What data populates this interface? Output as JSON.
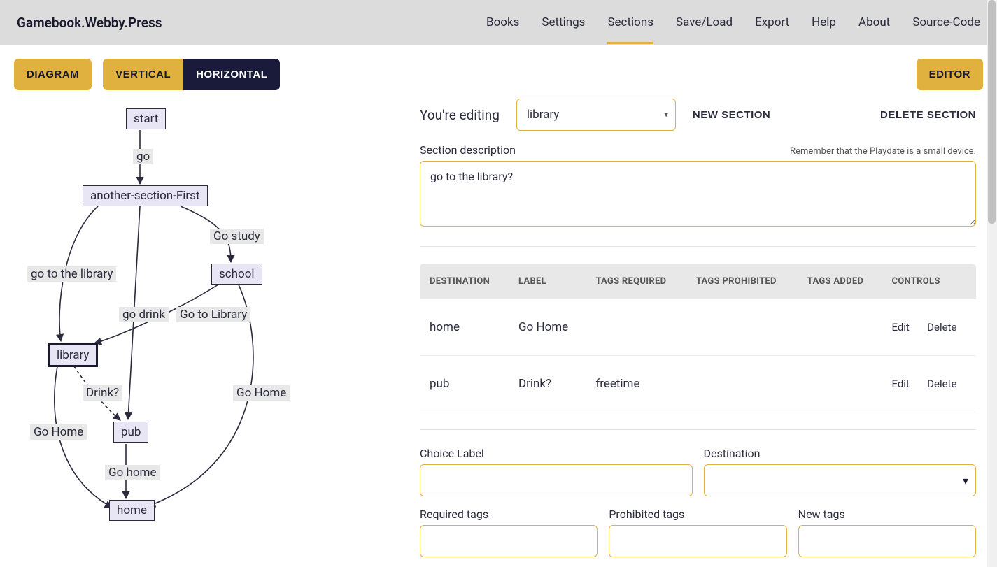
{
  "brand": "Gamebook.Webby.Press",
  "nav": {
    "books": "Books",
    "settings": "Settings",
    "sections": "Sections",
    "saveload": "Save/Load",
    "export": "Export",
    "help": "Help",
    "about": "About",
    "source": "Source-Code"
  },
  "toolbar": {
    "diagram": "DIAGRAM",
    "vertical": "VERTICAL",
    "horizontal": "HORIZONTAL",
    "editor": "EDITOR"
  },
  "diagram": {
    "nodes": {
      "start": "start",
      "another": "another-section-First",
      "school": "school",
      "library": "library",
      "pub": "pub",
      "home": "home"
    },
    "edgeLabels": {
      "go": "go",
      "goStudy": "Go study",
      "goToLibrary": "go to the library",
      "goDrink": "go drink",
      "goToLibrary2": "Go to Library",
      "drink": "Drink?",
      "goHomeLeft": "Go Home",
      "goHomeRight": "Go Home",
      "goHomePub": "Go home"
    }
  },
  "editor": {
    "editingLabel": "You're editing",
    "currentSection": "library",
    "newSection": "NEW SECTION",
    "deleteSection": "DELETE SECTION",
    "descLabel": "Section description",
    "descHint": "Remember that the Playdate is a small device.",
    "descValue": "go to the library?",
    "table": {
      "headers": {
        "destination": "DESTINATION",
        "label": "LABEL",
        "tagsRequired": "TAGS REQUIRED",
        "tagsProhibited": "TAGS PROHIBITED",
        "tagsAdded": "TAGS ADDED",
        "controls": "CONTROLS"
      },
      "rows": [
        {
          "destination": "home",
          "label": "Go Home",
          "tagsRequired": "",
          "tagsProhibited": "",
          "tagsAdded": ""
        },
        {
          "destination": "pub",
          "label": "Drink?",
          "tagsRequired": "freetime",
          "tagsProhibited": "",
          "tagsAdded": ""
        }
      ],
      "edit": "Edit",
      "delete": "Delete"
    },
    "form": {
      "choiceLabel": "Choice Label",
      "destination": "Destination",
      "requiredTags": "Required tags",
      "prohibitedTags": "Prohibited tags",
      "newTags": "New tags"
    }
  }
}
